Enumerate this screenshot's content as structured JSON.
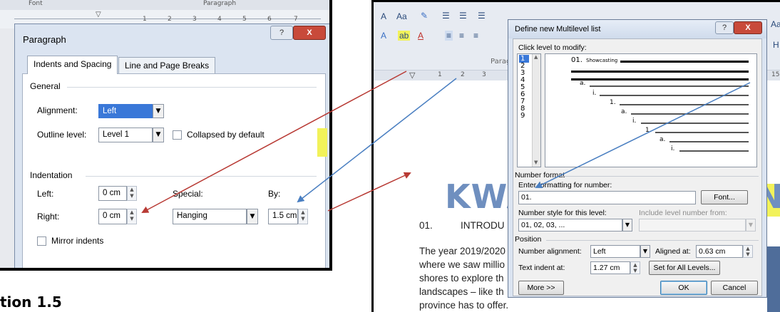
{
  "paragraph_dialog": {
    "ruler": {
      "font_label": "Font",
      "paragraph_label": "Paragraph",
      "numbers": [
        "1",
        "2",
        "3",
        "4",
        "5",
        "6",
        "7"
      ]
    },
    "title": "Paragraph",
    "help_button": "?",
    "close_button": "X",
    "tabs": [
      "Indents and Spacing",
      "Line and Page Breaks"
    ],
    "general": {
      "heading": "General",
      "alignment_label": "Alignment:",
      "alignment_value": "Left",
      "outline_label": "Outline level:",
      "outline_value": "Level 1",
      "collapsed_label": "Collapsed by default"
    },
    "indentation": {
      "heading": "Indentation",
      "left_label": "Left:",
      "left_value": "0 cm",
      "right_label": "Right:",
      "right_value": "0 cm",
      "special_label": "Special:",
      "special_value": "Hanging",
      "by_label": "By:",
      "by_value": "1.5 cm",
      "mirror_label": "Mirror indents"
    }
  },
  "section_heading": "tion 1.5",
  "word_window": {
    "ribbon": {
      "font_size_grow": "A",
      "change_case": "Aa",
      "paragraph_group": "Parag",
      "styles_partial_1": "Aa",
      "styles_partial_2": "H"
    },
    "ruler_numbers": [
      "1",
      "2",
      "3",
      "15"
    ],
    "document": {
      "title_part_1": "KWA",
      "title_part_2": "N",
      "heading_number": "01.",
      "heading_text": "INTRODU",
      "body_lines": [
        "The year 2019/2020",
        "where we saw millio",
        "shores to explore th",
        "landscapes – like th",
        "province has to offer."
      ]
    }
  },
  "multilevel_dialog": {
    "title": "Define new Multilevel list",
    "help_button": "?",
    "close_button": "X",
    "click_level_label": "Click level to modify:",
    "levels": [
      "1",
      "2",
      "3",
      "4",
      "5",
      "6",
      "7",
      "8",
      "9"
    ],
    "preview": {
      "level1_number": "01.",
      "level1_text": "Showcasting",
      "labels": [
        "a.",
        "i.",
        "1.",
        "a.",
        "i.",
        "1.",
        "a.",
        "i."
      ]
    },
    "number_format": {
      "heading": "Number format",
      "enter_label": "Enter formatting for number:",
      "enter_value": "01.",
      "font_button": "Font...",
      "style_label": "Number style for this level:",
      "style_value": "01, 02, 03, ...",
      "include_label": "Include level number from:"
    },
    "position": {
      "heading": "Position",
      "alignment_label": "Number alignment:",
      "alignment_value": "Left",
      "aligned_at_label": "Aligned at:",
      "aligned_at_value": "0.63 cm",
      "text_indent_label": "Text indent at:",
      "text_indent_value": "1.27 cm",
      "set_all_button": "Set for All Levels..."
    },
    "more_button": "More >>",
    "ok_button": "OK",
    "cancel_button": "Cancel"
  },
  "colors": {
    "red_arrow": "#b83a34",
    "blue_arrow": "#4a7fc1",
    "selection_blue": "#3a78d8",
    "dialog_frame": "#dbe4f1",
    "title_watermark": "#6f8fbf",
    "highlight_yellow": "#f2f25a"
  },
  "icons": [
    "close-icon",
    "help-icon",
    "dropdown-arrow-icon",
    "spinner-icon",
    "checkbox-icon",
    "ruler-indent-marker-icon",
    "bullets-icon",
    "numbering-icon",
    "multilevel-list-icon",
    "align-left-icon",
    "align-center-icon",
    "align-right-icon",
    "text-effects-icon",
    "highlight-icon",
    "font-color-icon",
    "clear-formatting-icon"
  ]
}
